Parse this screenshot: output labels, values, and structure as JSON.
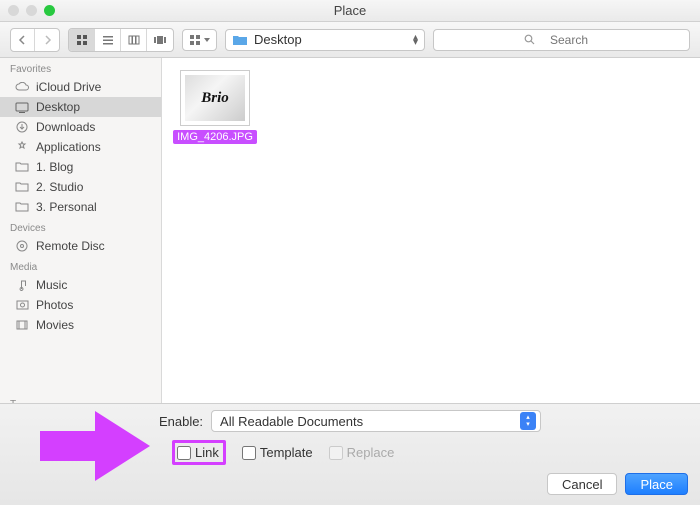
{
  "window": {
    "title": "Place"
  },
  "toolbar": {
    "location_label": "Desktop",
    "search_placeholder": "Search"
  },
  "sidebar": {
    "sections": [
      {
        "header": "Favorites",
        "items": [
          {
            "icon": "cloud-icon",
            "label": "iCloud Drive",
            "selected": false
          },
          {
            "icon": "desktop-icon",
            "label": "Desktop",
            "selected": true
          },
          {
            "icon": "downloads-icon",
            "label": "Downloads",
            "selected": false
          },
          {
            "icon": "applications-icon",
            "label": "Applications",
            "selected": false
          },
          {
            "icon": "folder-icon",
            "label": "1. Blog",
            "selected": false
          },
          {
            "icon": "folder-icon",
            "label": "2. Studio",
            "selected": false
          },
          {
            "icon": "folder-icon",
            "label": "3. Personal",
            "selected": false
          }
        ]
      },
      {
        "header": "Devices",
        "items": [
          {
            "icon": "disc-icon",
            "label": "Remote Disc",
            "selected": false
          }
        ]
      },
      {
        "header": "Media",
        "items": [
          {
            "icon": "music-icon",
            "label": "Music",
            "selected": false
          },
          {
            "icon": "photos-icon",
            "label": "Photos",
            "selected": false
          },
          {
            "icon": "movies-icon",
            "label": "Movies",
            "selected": false
          }
        ]
      },
      {
        "header": "Tags",
        "items": []
      }
    ]
  },
  "content": {
    "files": [
      {
        "thumb_text": "Brio",
        "name": "IMG_4206.JPG",
        "selected": true
      }
    ]
  },
  "footer": {
    "enable_label": "Enable:",
    "enable_value": "All Readable Documents",
    "link_label": "Link",
    "template_label": "Template",
    "replace_label": "Replace",
    "cancel_label": "Cancel",
    "place_label": "Place"
  },
  "colors": {
    "selection": "#c84eff",
    "primary": "#1e7fff",
    "annotation": "#d43fff"
  }
}
